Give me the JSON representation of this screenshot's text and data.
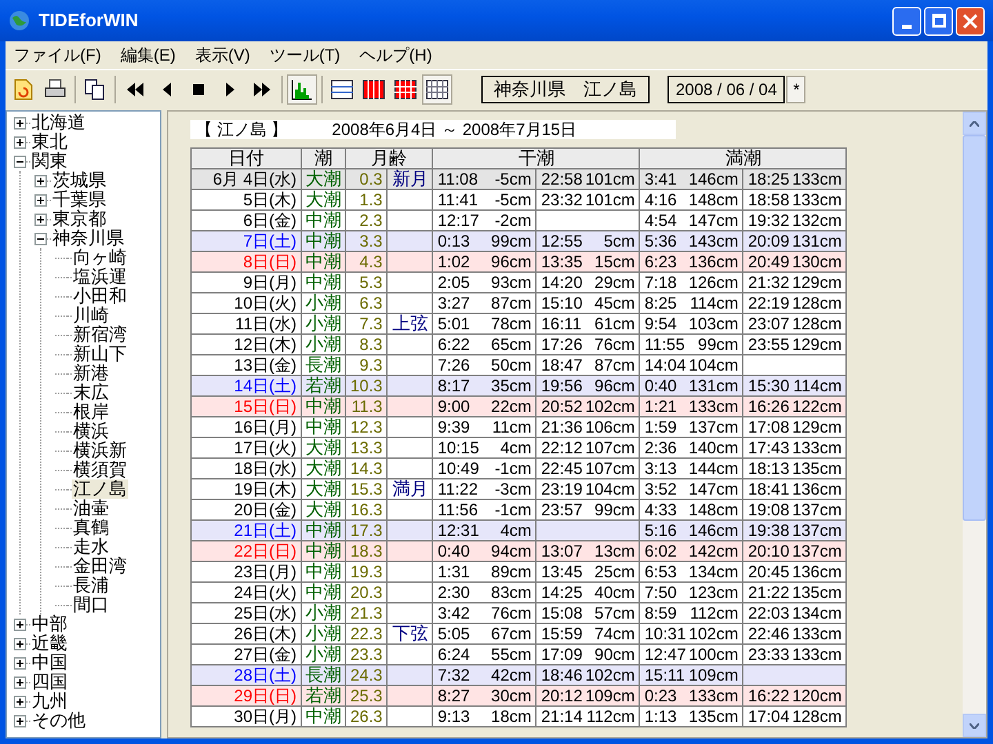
{
  "window": {
    "title": "TIDEforWIN"
  },
  "menu": [
    "ファイル(F)",
    "編集(E)",
    "表示(V)",
    "ツール(T)",
    "ヘルプ(H)"
  ],
  "toolbar": {
    "chart_pressed": true,
    "view_buttons": [
      {
        "selected": false
      },
      {
        "selected": false
      },
      {
        "selected": false
      },
      {
        "selected": true
      }
    ],
    "location": "神奈川県　江ノ島",
    "date": "2008 / 06 / 04",
    "star_button": "*"
  },
  "tree": [
    {
      "label": "北海道",
      "expanded": false,
      "selected": false
    },
    {
      "label": "東北",
      "expanded": false,
      "selected": false
    },
    {
      "label": "関東",
      "expanded": true,
      "selected": false,
      "children": [
        {
          "label": "茨城県",
          "expanded": false,
          "selected": false
        },
        {
          "label": "千葉県",
          "expanded": false,
          "selected": false
        },
        {
          "label": "東京都",
          "expanded": false,
          "selected": false
        },
        {
          "label": "神奈川県",
          "expanded": true,
          "selected": false,
          "children": [
            {
              "label": "向ヶ崎",
              "selected": false
            },
            {
              "label": "塩浜運",
              "selected": false
            },
            {
              "label": "小田和",
              "selected": false
            },
            {
              "label": "川崎",
              "selected": false
            },
            {
              "label": "新宿湾",
              "selected": false
            },
            {
              "label": "新山下",
              "selected": false
            },
            {
              "label": "新港",
              "selected": false
            },
            {
              "label": "末広",
              "selected": false
            },
            {
              "label": "根岸",
              "selected": false
            },
            {
              "label": "横浜",
              "selected": false
            },
            {
              "label": "横浜新",
              "selected": false
            },
            {
              "label": "横須賀",
              "selected": false
            },
            {
              "label": "江ノ島",
              "selected": true
            },
            {
              "label": "油壷",
              "selected": false
            },
            {
              "label": "真鶴",
              "selected": false
            },
            {
              "label": "走水",
              "selected": false
            },
            {
              "label": "金田湾",
              "selected": false
            },
            {
              "label": "長浦",
              "selected": false
            },
            {
              "label": "間口",
              "selected": false
            }
          ]
        }
      ]
    },
    {
      "label": "中部",
      "expanded": false,
      "selected": false
    },
    {
      "label": "近畿",
      "expanded": false,
      "selected": false
    },
    {
      "label": "中国",
      "expanded": false,
      "selected": false
    },
    {
      "label": "四国",
      "expanded": false,
      "selected": false
    },
    {
      "label": "九州",
      "expanded": false,
      "selected": false
    },
    {
      "label": "その他",
      "expanded": false,
      "selected": false
    }
  ],
  "report": {
    "station": "【 江ノ島 】",
    "period": "2008年6月4日 ～ 2008年7月15日"
  },
  "table": {
    "columns": [
      "日付",
      "潮",
      "月齢",
      "干潮",
      "満潮"
    ],
    "rows": [
      {
        "date": "6月 4日(水)",
        "kind": "weekday",
        "current": true,
        "tide": "大潮",
        "age": "0.3",
        "phase": "新月",
        "low": [
          [
            "11:08",
            "-5cm"
          ],
          [
            "22:58",
            "101cm"
          ]
        ],
        "high": [
          [
            "3:41",
            "146cm"
          ],
          [
            "18:25",
            "133cm"
          ]
        ]
      },
      {
        "date": "5日(木)",
        "kind": "weekday",
        "current": false,
        "tide": "大潮",
        "age": "1.3",
        "low": [
          [
            "11:41",
            "-5cm"
          ],
          [
            "23:32",
            "101cm"
          ]
        ],
        "high": [
          [
            "4:16",
            "148cm"
          ],
          [
            "18:58",
            "133cm"
          ]
        ]
      },
      {
        "date": "6日(金)",
        "kind": "weekday",
        "current": false,
        "tide": "中潮",
        "age": "2.3",
        "low": [
          [
            "12:17",
            "-2cm"
          ]
        ],
        "high": [
          [
            "4:54",
            "147cm"
          ],
          [
            "19:32",
            "132cm"
          ]
        ]
      },
      {
        "date": "7日(土)",
        "kind": "saturday",
        "current": false,
        "tide": "中潮",
        "age": "3.3",
        "low": [
          [
            "0:13",
            "99cm"
          ],
          [
            "12:55",
            "5cm"
          ]
        ],
        "high": [
          [
            "5:36",
            "143cm"
          ],
          [
            "20:09",
            "131cm"
          ]
        ]
      },
      {
        "date": "8日(日)",
        "kind": "sunday",
        "current": false,
        "tide": "中潮",
        "age": "4.3",
        "low": [
          [
            "1:02",
            "96cm"
          ],
          [
            "13:35",
            "15cm"
          ]
        ],
        "high": [
          [
            "6:23",
            "136cm"
          ],
          [
            "20:49",
            "130cm"
          ]
        ]
      },
      {
        "date": "9日(月)",
        "kind": "weekday",
        "current": false,
        "tide": "中潮",
        "age": "5.3",
        "low": [
          [
            "2:05",
            "93cm"
          ],
          [
            "14:20",
            "29cm"
          ]
        ],
        "high": [
          [
            "7:18",
            "126cm"
          ],
          [
            "21:32",
            "129cm"
          ]
        ]
      },
      {
        "date": "10日(火)",
        "kind": "weekday",
        "current": false,
        "tide": "小潮",
        "age": "6.3",
        "low": [
          [
            "3:27",
            "87cm"
          ],
          [
            "15:10",
            "45cm"
          ]
        ],
        "high": [
          [
            "8:25",
            "114cm"
          ],
          [
            "22:19",
            "128cm"
          ]
        ]
      },
      {
        "date": "11日(水)",
        "kind": "weekday",
        "current": false,
        "tide": "小潮",
        "age": "7.3",
        "phase": "上弦",
        "low": [
          [
            "5:01",
            "78cm"
          ],
          [
            "16:11",
            "61cm"
          ]
        ],
        "high": [
          [
            "9:54",
            "103cm"
          ],
          [
            "23:07",
            "128cm"
          ]
        ]
      },
      {
        "date": "12日(木)",
        "kind": "weekday",
        "current": false,
        "tide": "小潮",
        "age": "8.3",
        "low": [
          [
            "6:22",
            "65cm"
          ],
          [
            "17:26",
            "76cm"
          ]
        ],
        "high": [
          [
            "11:55",
            "99cm"
          ],
          [
            "23:55",
            "129cm"
          ]
        ]
      },
      {
        "date": "13日(金)",
        "kind": "weekday",
        "current": false,
        "tide": "長潮",
        "age": "9.3",
        "low": [
          [
            "7:26",
            "50cm"
          ],
          [
            "18:47",
            "87cm"
          ]
        ],
        "high": [
          [
            "14:04",
            "104cm"
          ]
        ]
      },
      {
        "date": "14日(土)",
        "kind": "saturday",
        "current": false,
        "tide": "若潮",
        "age": "10.3",
        "low": [
          [
            "8:17",
            "35cm"
          ],
          [
            "19:56",
            "96cm"
          ]
        ],
        "high": [
          [
            "0:40",
            "131cm"
          ],
          [
            "15:30",
            "114cm"
          ]
        ]
      },
      {
        "date": "15日(日)",
        "kind": "sunday",
        "current": false,
        "tide": "中潮",
        "age": "11.3",
        "low": [
          [
            "9:00",
            "22cm"
          ],
          [
            "20:52",
            "102cm"
          ]
        ],
        "high": [
          [
            "1:21",
            "133cm"
          ],
          [
            "16:26",
            "122cm"
          ]
        ]
      },
      {
        "date": "16日(月)",
        "kind": "weekday",
        "current": false,
        "tide": "中潮",
        "age": "12.3",
        "low": [
          [
            "9:39",
            "11cm"
          ],
          [
            "21:36",
            "106cm"
          ]
        ],
        "high": [
          [
            "1:59",
            "137cm"
          ],
          [
            "17:08",
            "129cm"
          ]
        ]
      },
      {
        "date": "17日(火)",
        "kind": "weekday",
        "current": false,
        "tide": "大潮",
        "age": "13.3",
        "low": [
          [
            "10:15",
            "4cm"
          ],
          [
            "22:12",
            "107cm"
          ]
        ],
        "high": [
          [
            "2:36",
            "140cm"
          ],
          [
            "17:43",
            "133cm"
          ]
        ]
      },
      {
        "date": "18日(水)",
        "kind": "weekday",
        "current": false,
        "tide": "大潮",
        "age": "14.3",
        "low": [
          [
            "10:49",
            "-1cm"
          ],
          [
            "22:45",
            "107cm"
          ]
        ],
        "high": [
          [
            "3:13",
            "144cm"
          ],
          [
            "18:13",
            "135cm"
          ]
        ]
      },
      {
        "date": "19日(木)",
        "kind": "weekday",
        "current": false,
        "tide": "大潮",
        "age": "15.3",
        "phase": "満月",
        "low": [
          [
            "11:22",
            "-3cm"
          ],
          [
            "23:19",
            "104cm"
          ]
        ],
        "high": [
          [
            "3:52",
            "147cm"
          ],
          [
            "18:41",
            "136cm"
          ]
        ]
      },
      {
        "date": "20日(金)",
        "kind": "weekday",
        "current": false,
        "tide": "大潮",
        "age": "16.3",
        "low": [
          [
            "11:56",
            "-1cm"
          ],
          [
            "23:57",
            "99cm"
          ]
        ],
        "high": [
          [
            "4:33",
            "148cm"
          ],
          [
            "19:08",
            "137cm"
          ]
        ]
      },
      {
        "date": "21日(土)",
        "kind": "saturday",
        "current": false,
        "tide": "中潮",
        "age": "17.3",
        "low": [
          [
            "12:31",
            "4cm"
          ]
        ],
        "high": [
          [
            "5:16",
            "146cm"
          ],
          [
            "19:38",
            "137cm"
          ]
        ]
      },
      {
        "date": "22日(日)",
        "kind": "sunday",
        "current": false,
        "tide": "中潮",
        "age": "18.3",
        "low": [
          [
            "0:40",
            "94cm"
          ],
          [
            "13:07",
            "13cm"
          ]
        ],
        "high": [
          [
            "6:02",
            "142cm"
          ],
          [
            "20:10",
            "137cm"
          ]
        ]
      },
      {
        "date": "23日(月)",
        "kind": "weekday",
        "current": false,
        "tide": "中潮",
        "age": "19.3",
        "low": [
          [
            "1:31",
            "89cm"
          ],
          [
            "13:45",
            "25cm"
          ]
        ],
        "high": [
          [
            "6:53",
            "134cm"
          ],
          [
            "20:45",
            "136cm"
          ]
        ]
      },
      {
        "date": "24日(火)",
        "kind": "weekday",
        "current": false,
        "tide": "中潮",
        "age": "20.3",
        "low": [
          [
            "2:30",
            "83cm"
          ],
          [
            "14:25",
            "40cm"
          ]
        ],
        "high": [
          [
            "7:50",
            "123cm"
          ],
          [
            "21:22",
            "135cm"
          ]
        ]
      },
      {
        "date": "25日(水)",
        "kind": "weekday",
        "current": false,
        "tide": "小潮",
        "age": "21.3",
        "low": [
          [
            "3:42",
            "76cm"
          ],
          [
            "15:08",
            "57cm"
          ]
        ],
        "high": [
          [
            "8:59",
            "112cm"
          ],
          [
            "22:03",
            "134cm"
          ]
        ]
      },
      {
        "date": "26日(木)",
        "kind": "weekday",
        "current": false,
        "tide": "小潮",
        "age": "22.3",
        "phase": "下弦",
        "low": [
          [
            "5:05",
            "67cm"
          ],
          [
            "15:59",
            "74cm"
          ]
        ],
        "high": [
          [
            "10:31",
            "102cm"
          ],
          [
            "22:46",
            "133cm"
          ]
        ]
      },
      {
        "date": "27日(金)",
        "kind": "weekday",
        "current": false,
        "tide": "小潮",
        "age": "23.3",
        "low": [
          [
            "6:24",
            "55cm"
          ],
          [
            "17:09",
            "90cm"
          ]
        ],
        "high": [
          [
            "12:47",
            "100cm"
          ],
          [
            "23:33",
            "133cm"
          ]
        ]
      },
      {
        "date": "28日(土)",
        "kind": "saturday",
        "current": false,
        "tide": "長潮",
        "age": "24.3",
        "low": [
          [
            "7:32",
            "42cm"
          ],
          [
            "18:46",
            "102cm"
          ]
        ],
        "high": [
          [
            "15:11",
            "109cm"
          ]
        ]
      },
      {
        "date": "29日(日)",
        "kind": "sunday",
        "current": false,
        "tide": "若潮",
        "age": "25.3",
        "low": [
          [
            "8:27",
            "30cm"
          ],
          [
            "20:12",
            "109cm"
          ]
        ],
        "high": [
          [
            "0:23",
            "133cm"
          ],
          [
            "16:22",
            "120cm"
          ]
        ]
      },
      {
        "date": "30日(月)",
        "kind": "weekday",
        "current": false,
        "tide": "中潮",
        "age": "26.3",
        "low": [
          [
            "9:13",
            "18cm"
          ],
          [
            "21:14",
            "112cm"
          ]
        ],
        "high": [
          [
            "1:13",
            "135cm"
          ],
          [
            "17:04",
            "128cm"
          ]
        ]
      }
    ]
  }
}
